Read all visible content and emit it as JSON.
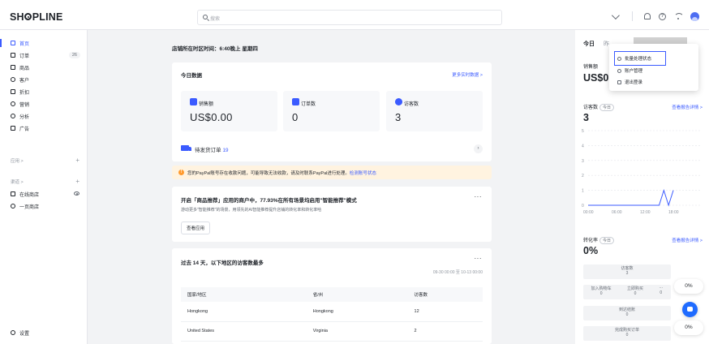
{
  "app": {
    "logo": "SHOPLINE"
  },
  "search": {
    "placeholder": "搜索"
  },
  "sidebar": {
    "items": [
      {
        "label": "首页",
        "icon": "home-icon",
        "active": true
      },
      {
        "label": "订单",
        "icon": "order-icon",
        "badge": "26"
      },
      {
        "label": "商品",
        "icon": "product-icon"
      },
      {
        "label": "客户",
        "icon": "customer-icon"
      },
      {
        "label": "折扣",
        "icon": "discount-icon"
      },
      {
        "label": "营销",
        "icon": "marketing-icon"
      },
      {
        "label": "分析",
        "icon": "analytics-icon"
      },
      {
        "label": "广告",
        "icon": "ads-icon"
      }
    ],
    "group_apps": "应用 >",
    "group_channels": "渠道 >",
    "channels": [
      {
        "label": "在线商店",
        "icon": "online-store-icon"
      },
      {
        "label": "一页商店",
        "icon": "one-page-store-icon"
      }
    ],
    "settings": "设置"
  },
  "main": {
    "store_time": "店铺所在时区时间：6:40晚上 星期四",
    "today": {
      "title": "今日数据",
      "more_link": "更多实时数据 >",
      "metrics": [
        {
          "label": "销售额",
          "value": "US$0.00",
          "color": "#3b5bff"
        },
        {
          "label": "订单数",
          "value": "0",
          "color": "#3b5bff"
        },
        {
          "label": "访客数",
          "value": "3",
          "color": "#3b5bff"
        }
      ]
    },
    "pending": {
      "label": "待发货订单",
      "count": "19"
    },
    "notice": {
      "text": "您的PayPal账号存在收款问题，可能导致无法收款，请及时联系PayPal进行处理。",
      "link": "检测账号状态"
    },
    "promo": {
      "title": "开启「商品推荐」应用的商户中，77.93%在所有场景均启用\"智能推荐\"模式",
      "desc": "游动更多\"智能推荐\"的场景，用领先的AI智能推荐提升店铺的转化率和转化率哈",
      "button": "查看应用",
      "more": "···"
    },
    "visitors": {
      "title": "过去 14 天，以下地区的访客数最多",
      "range": "09-30 00:00 至 10-13 00:00",
      "more": "···",
      "columns": [
        "国家/地区",
        "省/州",
        "访客数"
      ],
      "rows": [
        [
          "Hongkong",
          "Hongkong",
          "12"
        ],
        [
          "United States",
          "Virginia",
          "2"
        ]
      ]
    }
  },
  "right": {
    "tab_today": "今日",
    "tab_other": "昨",
    "sales_label": "销售额",
    "sales_value": "US$0.",
    "visitors_label": "访客数",
    "visitors_tag": "今日",
    "visitors_link": "查看报告详情 >",
    "visitors_value": "3",
    "chart_data": {
      "type": "line",
      "x": [
        "00:00",
        "06:00",
        "12:00",
        "18:00"
      ],
      "y_ticks": [
        "5",
        "4",
        "3",
        "2",
        "1",
        "0"
      ],
      "ylim": [
        0,
        5
      ],
      "series": [
        {
          "values": [
            [
              0,
              0
            ],
            [
              6,
              0
            ],
            [
              12,
              0
            ],
            [
              15,
              0
            ],
            [
              16,
              1
            ],
            [
              17,
              0
            ],
            [
              18,
              1
            ]
          ]
        }
      ]
    },
    "conversion_label": "转化率",
    "conversion_tag": "今日",
    "conversion_link": "查看报告详情 >",
    "conversion_value": "0%",
    "funnel": [
      {
        "label": "访客数",
        "value": "3"
      },
      {
        "labels": [
          "加入购物车",
          "立即购买",
          "···"
        ],
        "values": [
          "0",
          "0",
          "0"
        ]
      },
      {
        "label": "到达结账",
        "value": "0"
      },
      {
        "label": "完成购买订单",
        "value": "0"
      }
    ],
    "pct_pills": [
      "0%",
      "0%"
    ]
  },
  "dropdown": {
    "items": [
      {
        "label": "批量处理状态",
        "icon": "clock-icon"
      },
      {
        "label": "账户管理",
        "icon": "account-icon"
      },
      {
        "label": "退出登录",
        "icon": "logout-icon"
      }
    ]
  }
}
